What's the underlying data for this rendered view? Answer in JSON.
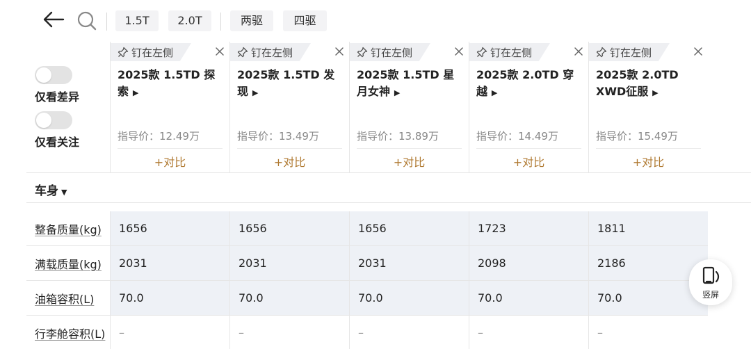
{
  "topbar": {
    "icons": {
      "back": "arrow-left-icon",
      "search": "search-icon"
    },
    "chips": [
      "1.5T",
      "2.0T",
      "两驱",
      "四驱"
    ]
  },
  "filters": {
    "diff_only": "仅看差异",
    "focus_only": "仅看关注"
  },
  "pin_label": "钉在左侧",
  "compare_label": "+对比",
  "models": [
    {
      "name": "2025款 1.5TD 探索",
      "price": "指导价：12.49万"
    },
    {
      "name": "2025款 1.5TD 发现",
      "price": "指导价：13.49万"
    },
    {
      "name": "2025款 1.5TD 星月女神",
      "price": "指导价：13.89万"
    },
    {
      "name": "2025款 2.0TD 穿越",
      "price": "指导价：14.49万"
    },
    {
      "name": "2025款 2.0TD XWD征服",
      "price": "指导价：15.49万"
    }
  ],
  "section": {
    "title": "车身"
  },
  "rows": [
    {
      "label": "整备质量(kg)",
      "values": [
        "1656",
        "1656",
        "1656",
        "1723",
        "1811"
      ]
    },
    {
      "label": "满载质量(kg)",
      "values": [
        "2031",
        "2031",
        "2031",
        "2098",
        "2186"
      ]
    },
    {
      "label": "油箱容积(L)",
      "values": [
        "70.0",
        "70.0",
        "70.0",
        "70.0",
        "70.0"
      ]
    },
    {
      "label": "行李舱容积(L)",
      "values": [
        "–",
        "–",
        "–",
        "–",
        "–"
      ]
    }
  ],
  "float_button": {
    "label": "竖屏",
    "icon": "portrait-rotate-icon"
  }
}
